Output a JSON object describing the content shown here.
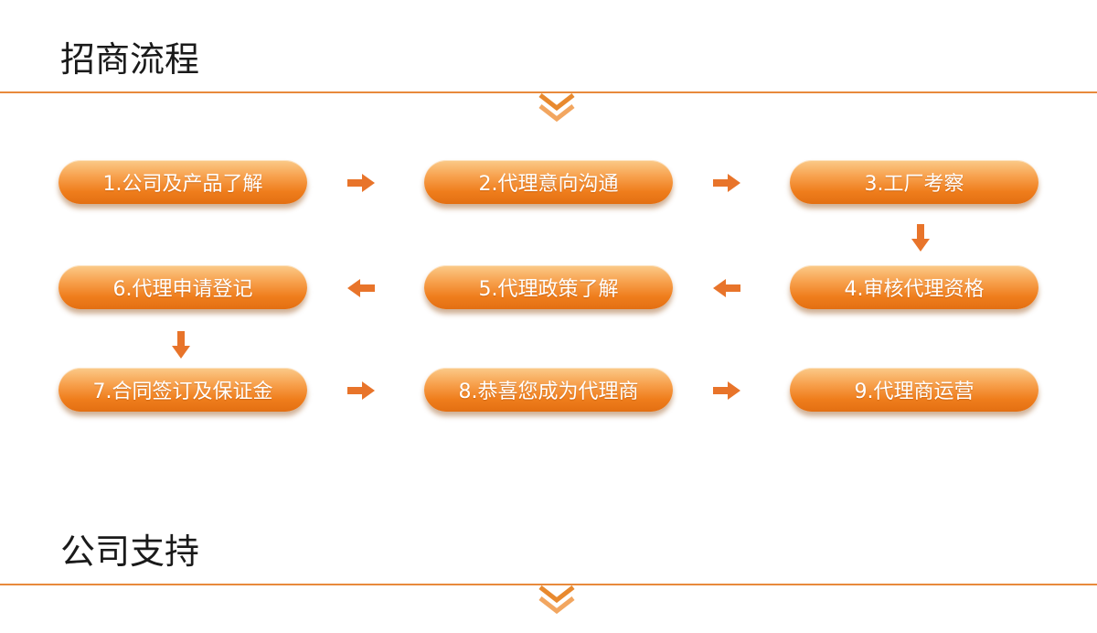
{
  "sections": {
    "process_title": "招商流程",
    "support_title": "公司支持"
  },
  "steps": [
    "1.公司及产品了解",
    "2.代理意向沟通",
    "3.工厂考察",
    "4.审核代理资格",
    "5.代理政策了解",
    "6.代理申请登记",
    "7.合同签订及保证金",
    "8.恭喜您成为代理商",
    "9.代理商运营"
  ],
  "colors": {
    "accent": "#e88a3c",
    "arrow": "#e8742a",
    "pill_top": "#fbcb8a",
    "pill_bottom": "#e36f12"
  },
  "icons": {
    "chevron": "double-chevron-down-icon",
    "arrow_right": "arrow-right-icon",
    "arrow_left": "arrow-left-icon",
    "arrow_down": "arrow-down-icon"
  }
}
